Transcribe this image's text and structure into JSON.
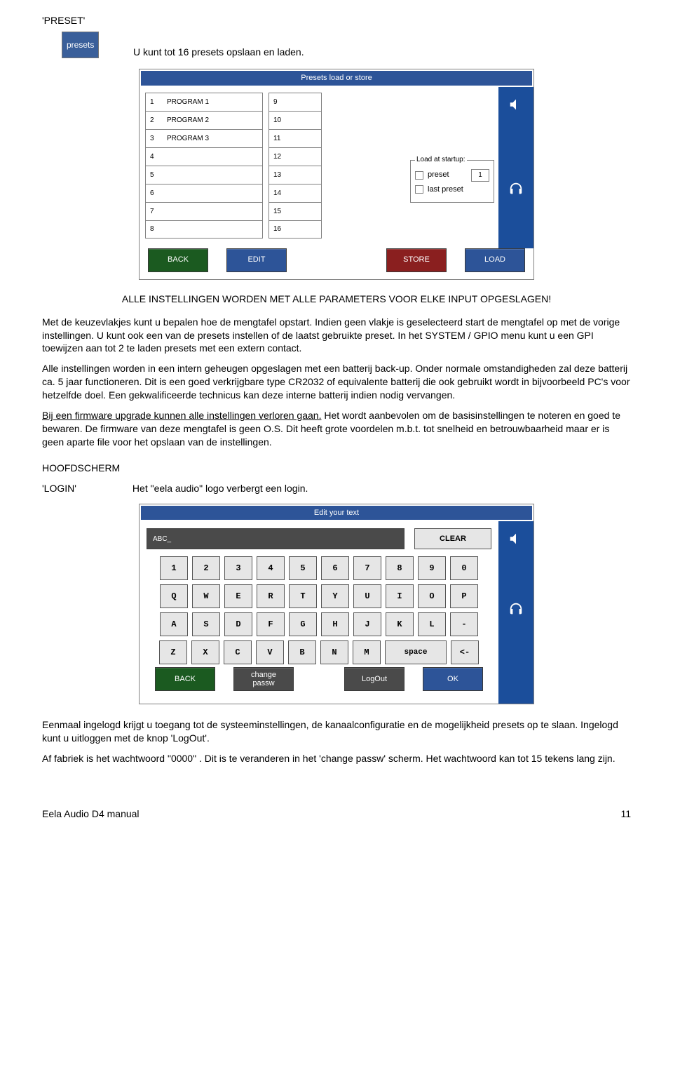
{
  "heading_preset": "'PRESET'",
  "badge_presets": "presets",
  "intro_line": "U kunt tot 16 presets opslaan en laden.",
  "preset_panel": {
    "title": "Presets load or store",
    "col_a": [
      {
        "n": "1",
        "name": "PROGRAM 1"
      },
      {
        "n": "2",
        "name": "PROGRAM 2"
      },
      {
        "n": "3",
        "name": "PROGRAM 3"
      },
      {
        "n": "4",
        "name": ""
      },
      {
        "n": "5",
        "name": ""
      },
      {
        "n": "6",
        "name": ""
      },
      {
        "n": "7",
        "name": ""
      },
      {
        "n": "8",
        "name": ""
      }
    ],
    "col_b": [
      "9",
      "10",
      "11",
      "12",
      "13",
      "14",
      "15",
      "16"
    ],
    "startup": {
      "legend": "Load at startup:",
      "opt1": "preset",
      "opt1_num": "1",
      "opt2": "last preset"
    },
    "buttons": {
      "back": "BACK",
      "edit": "EDIT",
      "store": "STORE",
      "load": "LOAD"
    }
  },
  "body_text": {
    "line_center": "ALLE  INSTELLINGEN WORDEN MET ALLE PARAMETERS VOOR ELKE INPUT OPGESLAGEN!",
    "p1": "Met de keuzevlakjes kunt u bepalen hoe de mengtafel opstart. Indien geen vlakje is geselecteerd start de mengtafel op met de vorige instellingen. U kunt ook een van de presets instellen of de laatst gebruikte preset. In het SYSTEM / GPIO menu kunt u een GPI toewijzen aan tot 2 te laden presets met een extern contact.",
    "p2": "Alle instellingen worden in een intern geheugen opgeslagen met een batterij back-up. Onder normale omstandigheden zal deze batterij ca. 5 jaar functioneren. Dit is een goed verkrijgbare type CR2032 of equivalente batterij die ook gebruikt wordt in bijvoorbeeld PC's voor hetzelfde doel. Een gekwalificeerde technicus kan deze interne batterij indien nodig vervangen.",
    "p3_u": "Bij een firmware upgrade kunnen alle instellingen verloren gaan.",
    "p3_rest": " Het wordt aanbevolen om de basisinstellingen te noteren en goed te bewaren. De firmware van deze mengtafel is geen O.S. Dit heeft grote voordelen m.b.t. tot snelheid en betrouwbaarheid maar er is geen aparte file voor het opslaan van de instellingen.",
    "hoofdscherm": "HOOFDSCHERM",
    "login_label": "'LOGIN'",
    "login_text": "Het \"eela audio\" logo verbergt een login."
  },
  "keyboard_panel": {
    "title": "Edit your text",
    "input_value": "ABC_",
    "clear": "CLEAR",
    "rows": [
      [
        "1",
        "2",
        "3",
        "4",
        "5",
        "6",
        "7",
        "8",
        "9",
        "0"
      ],
      [
        "Q",
        "W",
        "E",
        "R",
        "T",
        "Y",
        "U",
        "I",
        "O",
        "P"
      ],
      [
        "A",
        "S",
        "D",
        "F",
        "G",
        "H",
        "J",
        "K",
        "L",
        "-"
      ],
      [
        "Z",
        "X",
        "C",
        "V",
        "B",
        "N",
        "M",
        "space",
        "<-"
      ]
    ],
    "buttons": {
      "back": "BACK",
      "change": "change\npassw",
      "logout": "LogOut",
      "ok": "OK"
    }
  },
  "closing": {
    "p1": "Eenmaal ingelogd krijgt u toegang tot de systeeminstellingen, de kanaalconfiguratie en de mogelijkheid presets op te slaan. Ingelogd kunt u uitloggen met de knop 'LogOut'.",
    "p2": "Af fabriek is het wachtwoord \"0000\" . Dit is te veranderen in het 'change passw' scherm. Het wachtwoord kan tot 15 tekens lang zijn."
  },
  "footer": {
    "left": "Eela Audio D4 manual",
    "right": "11"
  }
}
